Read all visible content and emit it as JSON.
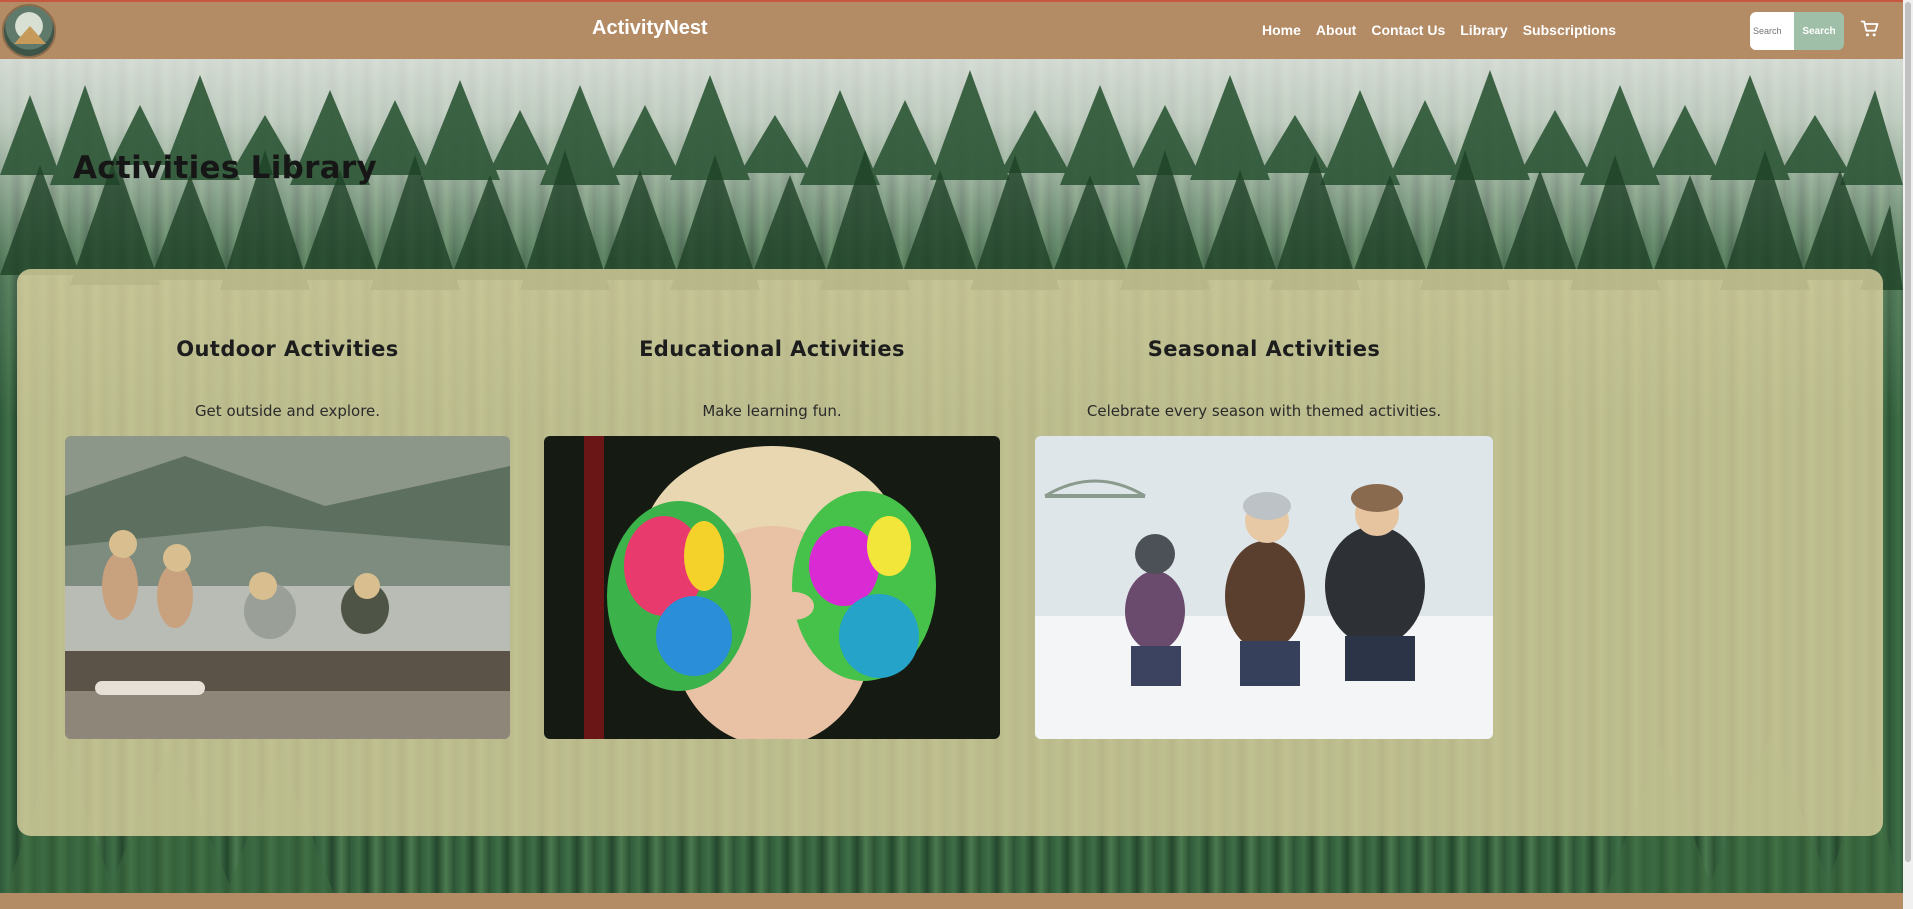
{
  "header": {
    "brand": "ActivityNest",
    "nav": [
      {
        "label": "Home"
      },
      {
        "label": "About"
      },
      {
        "label": "Contact Us"
      },
      {
        "label": "Library"
      },
      {
        "label": "Subscriptions"
      }
    ],
    "search_placeholder": "Search",
    "search_button": "Search",
    "cart_icon": "cart-icon"
  },
  "page": {
    "title": "Activities Library"
  },
  "categories": [
    {
      "title": "Outdoor Activities",
      "description": "Get outside and explore.",
      "image": "children-by-lake"
    },
    {
      "title": "Educational Activities",
      "description": "Make learning fun.",
      "image": "painted-hands"
    },
    {
      "title": "Seasonal Activities",
      "description": "Celebrate every season with themed activities.",
      "image": "family-in-snow"
    }
  ],
  "colors": {
    "header": "#b38b65",
    "panel": "#e2d6a4",
    "search_button": "#9fbfa8"
  }
}
